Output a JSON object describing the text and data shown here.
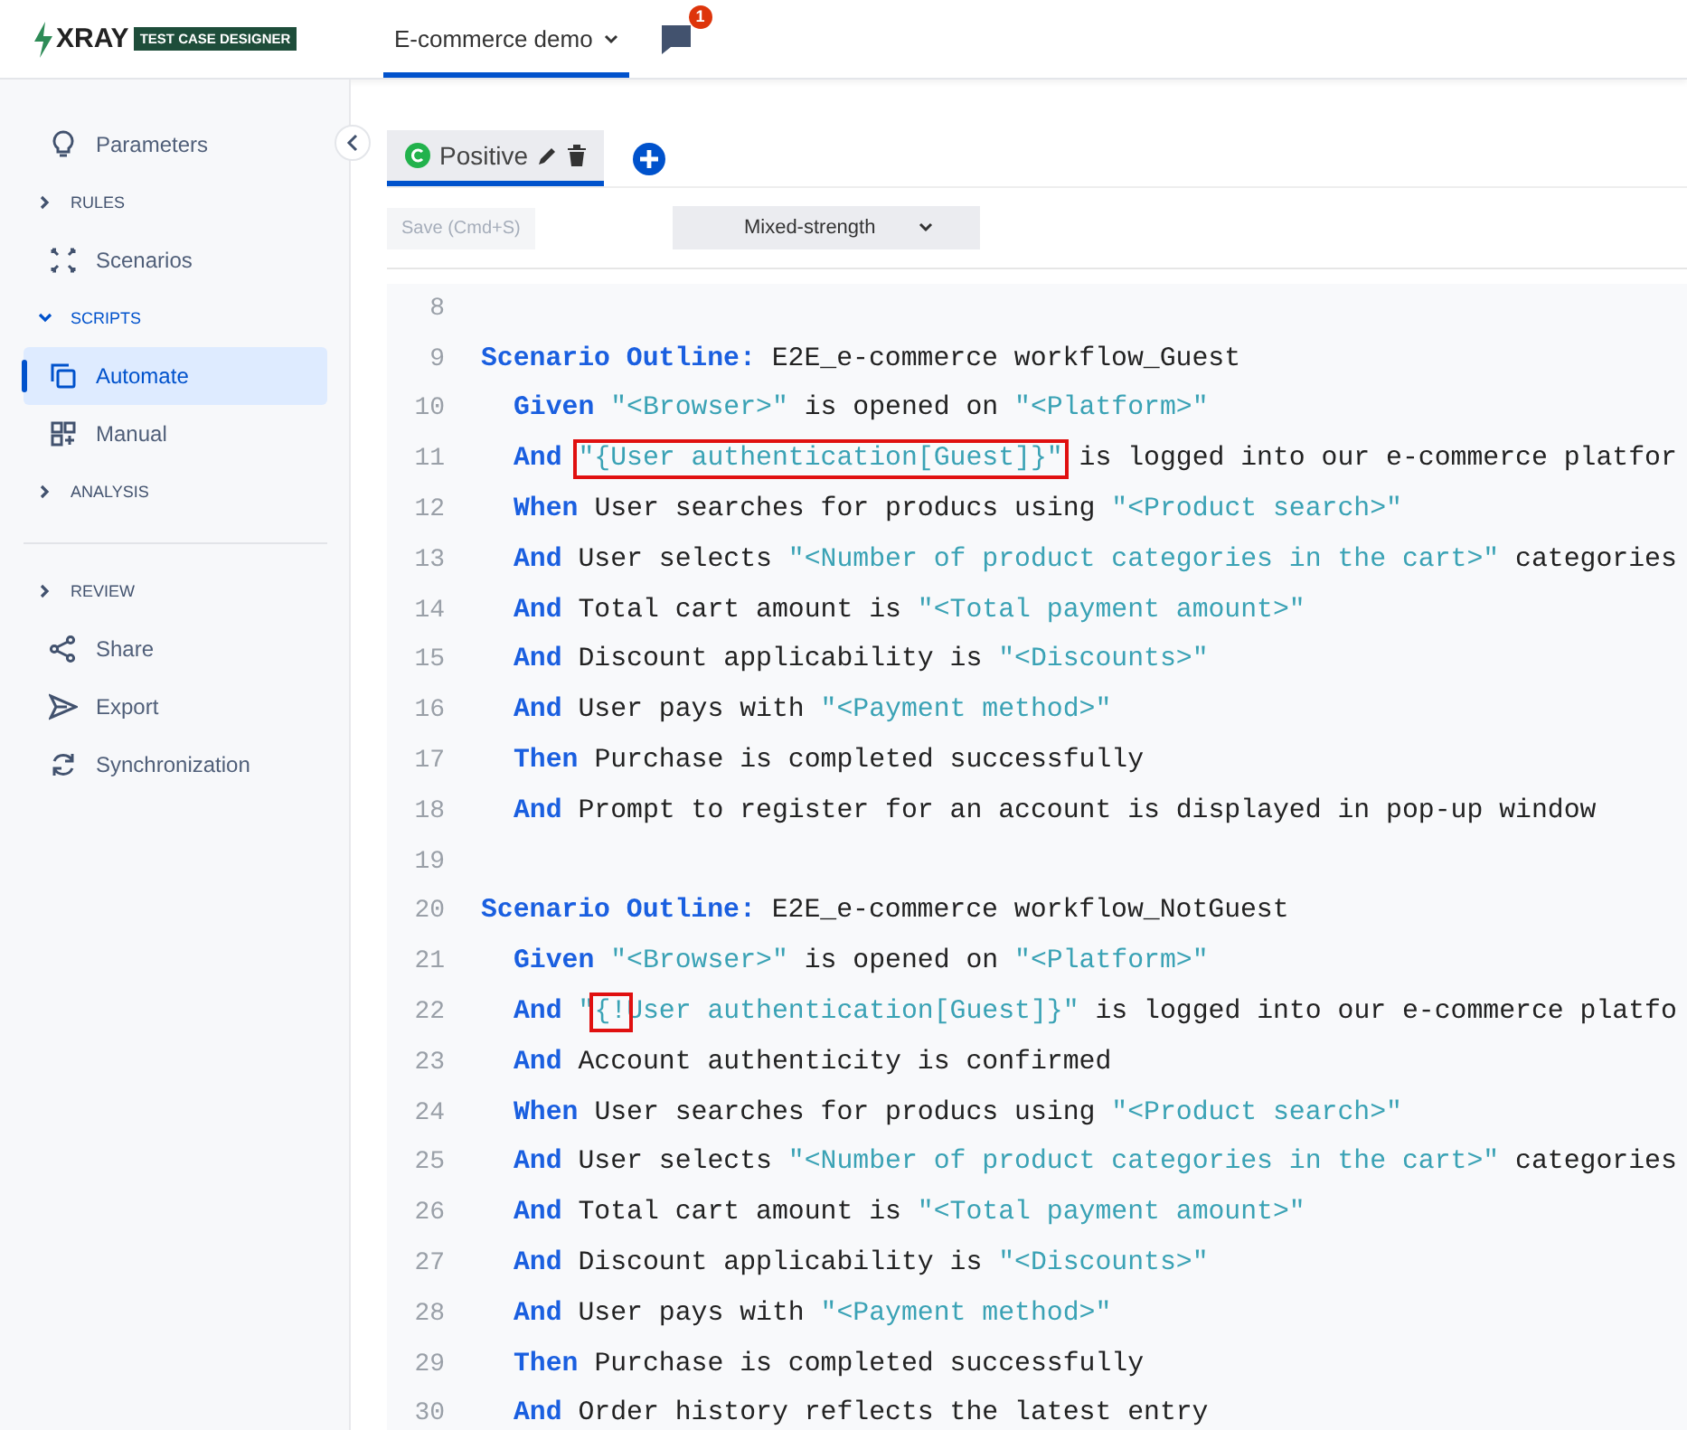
{
  "header": {
    "logo": "XRAY",
    "logo_badge": "TEST CASE DESIGNER",
    "project": {
      "label": "E-commerce demo",
      "selected": true
    },
    "notifications": "1"
  },
  "sidebar": {
    "items": [
      {
        "kind": "item",
        "label": "Parameters",
        "selected": false
      },
      {
        "kind": "section",
        "label": "RULES",
        "expanded": false
      },
      {
        "kind": "item",
        "label": "Scenarios",
        "selected": false
      },
      {
        "kind": "section",
        "label": "SCRIPTS",
        "expanded": true
      },
      {
        "kind": "item",
        "label": "Automate",
        "selected": true
      },
      {
        "kind": "item",
        "label": "Manual",
        "selected": false
      },
      {
        "kind": "section",
        "label": "ANALYSIS",
        "expanded": false
      },
      {
        "kind": "divider"
      },
      {
        "kind": "section",
        "label": "REVIEW",
        "expanded": false
      },
      {
        "kind": "item",
        "label": "Share",
        "selected": false
      },
      {
        "kind": "item",
        "label": "Export",
        "selected": false
      },
      {
        "kind": "item",
        "label": "Synchronization",
        "selected": false
      }
    ]
  },
  "tabs": [
    {
      "label": "Positive",
      "selected": true
    }
  ],
  "toolbar": {
    "save": "Save (Cmd+S)",
    "save_disabled": true,
    "strength": "Mixed-strength"
  },
  "editor": {
    "lines": [
      {
        "n": "8"
      },
      {
        "n": "9",
        "indented": false,
        "tokens": [
          {
            "kind": "kw",
            "text": "Scenario Outline: "
          },
          {
            "kind": "text",
            "text": "E2E_e-commerce workflow_Guest"
          }
        ]
      },
      {
        "n": "10",
        "indented": true,
        "tokens": [
          {
            "kind": "kw",
            "text": "Given "
          },
          {
            "kind": "str",
            "text": "\"<Browser>\""
          },
          {
            "kind": "text",
            "text": " is opened on "
          },
          {
            "kind": "str",
            "text": "\"<Platform>\""
          }
        ]
      },
      {
        "n": "11",
        "indented": true,
        "tokens": [
          {
            "kind": "kw",
            "text": "And "
          },
          {
            "kind": "str",
            "text": "\"{User authentication[Guest]}\"",
            "boxed": true
          },
          {
            "kind": "text",
            "text": " is logged into our e-commerce platfor"
          }
        ]
      },
      {
        "n": "12",
        "indented": true,
        "tokens": [
          {
            "kind": "kw",
            "text": "When "
          },
          {
            "kind": "text",
            "text": "User searches for producs using "
          },
          {
            "kind": "str",
            "text": "\"<Product search>\""
          }
        ]
      },
      {
        "n": "13",
        "indented": true,
        "tokens": [
          {
            "kind": "kw",
            "text": "And "
          },
          {
            "kind": "text",
            "text": "User selects "
          },
          {
            "kind": "str",
            "text": "\"<Number of product categories in the cart>\""
          },
          {
            "kind": "text",
            "text": " categories"
          }
        ]
      },
      {
        "n": "14",
        "indented": true,
        "tokens": [
          {
            "kind": "kw",
            "text": "And "
          },
          {
            "kind": "text",
            "text": "Total cart amount is "
          },
          {
            "kind": "str",
            "text": "\"<Total payment amount>\""
          }
        ]
      },
      {
        "n": "15",
        "indented": true,
        "tokens": [
          {
            "kind": "kw",
            "text": "And "
          },
          {
            "kind": "text",
            "text": "Discount applicability is "
          },
          {
            "kind": "str",
            "text": "\"<Discounts>\""
          }
        ]
      },
      {
        "n": "16",
        "indented": true,
        "tokens": [
          {
            "kind": "kw",
            "text": "And "
          },
          {
            "kind": "text",
            "text": "User pays with "
          },
          {
            "kind": "str",
            "text": "\"<Payment method>\""
          }
        ]
      },
      {
        "n": "17",
        "indented": true,
        "tokens": [
          {
            "kind": "kw",
            "text": "Then "
          },
          {
            "kind": "text",
            "text": "Purchase is completed successfully"
          }
        ]
      },
      {
        "n": "18",
        "indented": true,
        "tokens": [
          {
            "kind": "kw",
            "text": "And "
          },
          {
            "kind": "text",
            "text": "Prompt to register for an account is displayed in pop-up window"
          }
        ]
      },
      {
        "n": "19"
      },
      {
        "n": "20",
        "indented": false,
        "tokens": [
          {
            "kind": "kw",
            "text": "Scenario Outline: "
          },
          {
            "kind": "text",
            "text": "E2E_e-commerce workflow_NotGuest"
          }
        ]
      },
      {
        "n": "21",
        "indented": true,
        "tokens": [
          {
            "kind": "kw",
            "text": "Given "
          },
          {
            "kind": "str",
            "text": "\"<Browser>\""
          },
          {
            "kind": "text",
            "text": " is opened on "
          },
          {
            "kind": "str",
            "text": "\"<Platform>\""
          }
        ]
      },
      {
        "n": "22",
        "indented": true,
        "tokens": [
          {
            "kind": "kw",
            "text": "And "
          },
          {
            "kind": "str",
            "text": "\""
          },
          {
            "kind": "str",
            "text": "{!",
            "boxed": true
          },
          {
            "kind": "str",
            "text": "User authentication[Guest]}\""
          },
          {
            "kind": "text",
            "text": " is logged into our e-commerce platfo"
          }
        ]
      },
      {
        "n": "23",
        "indented": true,
        "tokens": [
          {
            "kind": "kw",
            "text": "And "
          },
          {
            "kind": "text",
            "text": "Account authenticity is confirmed"
          }
        ]
      },
      {
        "n": "24",
        "indented": true,
        "tokens": [
          {
            "kind": "kw",
            "text": "When "
          },
          {
            "kind": "text",
            "text": "User searches for producs using "
          },
          {
            "kind": "str",
            "text": "\"<Product search>\""
          }
        ]
      },
      {
        "n": "25",
        "indented": true,
        "tokens": [
          {
            "kind": "kw",
            "text": "And "
          },
          {
            "kind": "text",
            "text": "User selects "
          },
          {
            "kind": "str",
            "text": "\"<Number of product categories in the cart>\""
          },
          {
            "kind": "text",
            "text": " categories"
          }
        ]
      },
      {
        "n": "26",
        "indented": true,
        "tokens": [
          {
            "kind": "kw",
            "text": "And "
          },
          {
            "kind": "text",
            "text": "Total cart amount is "
          },
          {
            "kind": "str",
            "text": "\"<Total payment amount>\""
          }
        ]
      },
      {
        "n": "27",
        "indented": true,
        "tokens": [
          {
            "kind": "kw",
            "text": "And "
          },
          {
            "kind": "text",
            "text": "Discount applicability is "
          },
          {
            "kind": "str",
            "text": "\"<Discounts>\""
          }
        ]
      },
      {
        "n": "28",
        "indented": true,
        "tokens": [
          {
            "kind": "kw",
            "text": "And "
          },
          {
            "kind": "text",
            "text": "User pays with "
          },
          {
            "kind": "str",
            "text": "\"<Payment method>\""
          }
        ]
      },
      {
        "n": "29",
        "indented": true,
        "tokens": [
          {
            "kind": "kw",
            "text": "Then "
          },
          {
            "kind": "text",
            "text": "Purchase is completed successfully"
          }
        ]
      },
      {
        "n": "30",
        "indented": true,
        "tokens": [
          {
            "kind": "kw",
            "text": "And "
          },
          {
            "kind": "text",
            "text": "Order history reflects the latest entry"
          }
        ]
      }
    ]
  }
}
